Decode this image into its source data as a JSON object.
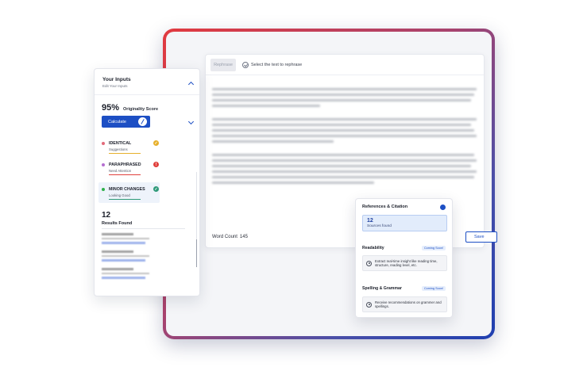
{
  "editor": {
    "rephrase_label": "Rephrase",
    "hint": "Select the text to rephrase",
    "word_count_label": "Word Count",
    "word_count": "145",
    "save_label": "Save"
  },
  "inputs": {
    "title": "Your Inputs",
    "subtitle": "Edit Your Inputs",
    "score": "95%",
    "score_label": "Originality Score",
    "calculate_label": "Calculate",
    "categories": [
      {
        "name": "IDENTICAL",
        "status": "Suggestions",
        "color": "#e7b02c",
        "dot": "#e26a7a"
      },
      {
        "name": "PARAPHRASED",
        "status": "Need Attention",
        "color": "#e0403c",
        "dot": "#b56fd0"
      },
      {
        "name": "MINOR CHANGES",
        "status": "Looking Good",
        "color": "#2f9a79",
        "dot": "#2fb04b"
      }
    ],
    "results_count": "12",
    "results_label": "Results Found"
  },
  "refs": {
    "title": "References & Citation",
    "sources_count": "12",
    "sources_label": "Sources found",
    "readability_title": "Readability",
    "readability_badge": "Coming Soon!",
    "readability_text": "Extract real-time insight like reading time, structure, reading level, etc.",
    "spelling_title": "Spelling & Grammar",
    "spelling_badge": "Coming Soon!",
    "spelling_text": "Receive recommendations on grammer and spellings."
  },
  "colors": {
    "accent": "#1d4fc4",
    "frame_start": "#e23a3f",
    "frame_end": "#1f3fb0"
  }
}
